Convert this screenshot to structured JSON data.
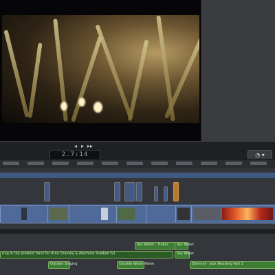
{
  "transport": {
    "timecode": "2.7:14",
    "prev_label": "◂",
    "play_label": "▸",
    "next_label": "▸▸",
    "tools_label": "◔ ▾"
  },
  "colors": {
    "accent_blue": "#3e5a80",
    "clip_blue": "#4f6a98",
    "audio_green": "#3d7d33",
    "clip_orange": "#b7792b"
  },
  "timeline": {
    "audio_clips": [
      {
        "text": "Sky Water - Trailer"
      },
      {
        "text": "Sky Water"
      },
      {
        "text": "ring in the pretend track for Arne Oravsky & Akumote Shadow (V)"
      },
      {
        "text": "Sky Water"
      },
      {
        "text": "Outside Singing"
      },
      {
        "text": "Outside Water Noise"
      },
      {
        "text": "Element - Jack Neuberg Part 1"
      }
    ]
  }
}
